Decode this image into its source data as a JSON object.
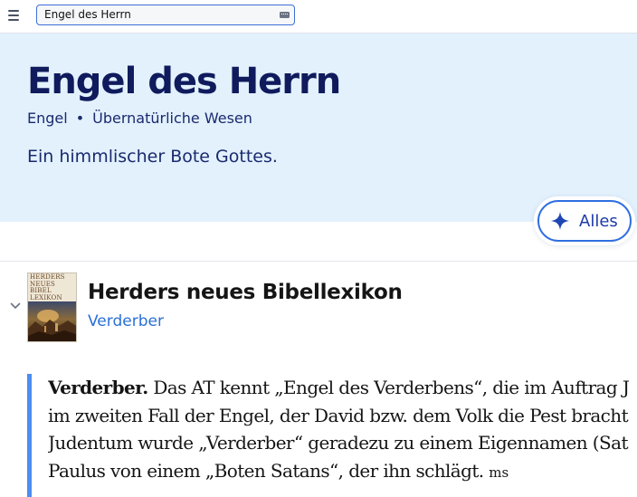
{
  "header": {
    "menu_icon": "hamburger-menu-icon",
    "search": {
      "value": "Engel des Herrn",
      "placeholder": ""
    },
    "keyboard_icon": "keyboard-icon"
  },
  "topic": {
    "title": "Engel des Herrn",
    "tags": [
      "Engel",
      "Übernatürliche Wesen"
    ],
    "tag_separator": "•",
    "description": "Ein himmlischer Bote Gottes."
  },
  "alles_button": {
    "label": "Alles",
    "icon": "sparkle-icon"
  },
  "resource": {
    "expand_icon": "chevron-down-icon",
    "cover_title_lines": [
      "HERDERS",
      "NEUES",
      "BIBEL",
      "LEXIKON"
    ],
    "title": "Herders neues Bibellexikon",
    "link": "Verderber",
    "article_head": "Verderber.",
    "article_lines": [
      " Das AT kennt „Engel des Verderbens“, die im Auftrag J",
      "im zweiten Fall der Engel, der David bzw. dem Volk die Pest bracht",
      "Judentum wurde „Verderber“ geradezu zu einem Eigennamen (Sat",
      "Paulus von einem „Boten Satans“, der ihn schlägt. "
    ],
    "article_author": "ms"
  },
  "colors": {
    "hero_background": "#e3f1fd",
    "title_navy": "#0f1b5c",
    "link_blue": "#2a6fd6",
    "accent_blue": "#2f6ee0",
    "quote_bar": "#4b8df0"
  }
}
